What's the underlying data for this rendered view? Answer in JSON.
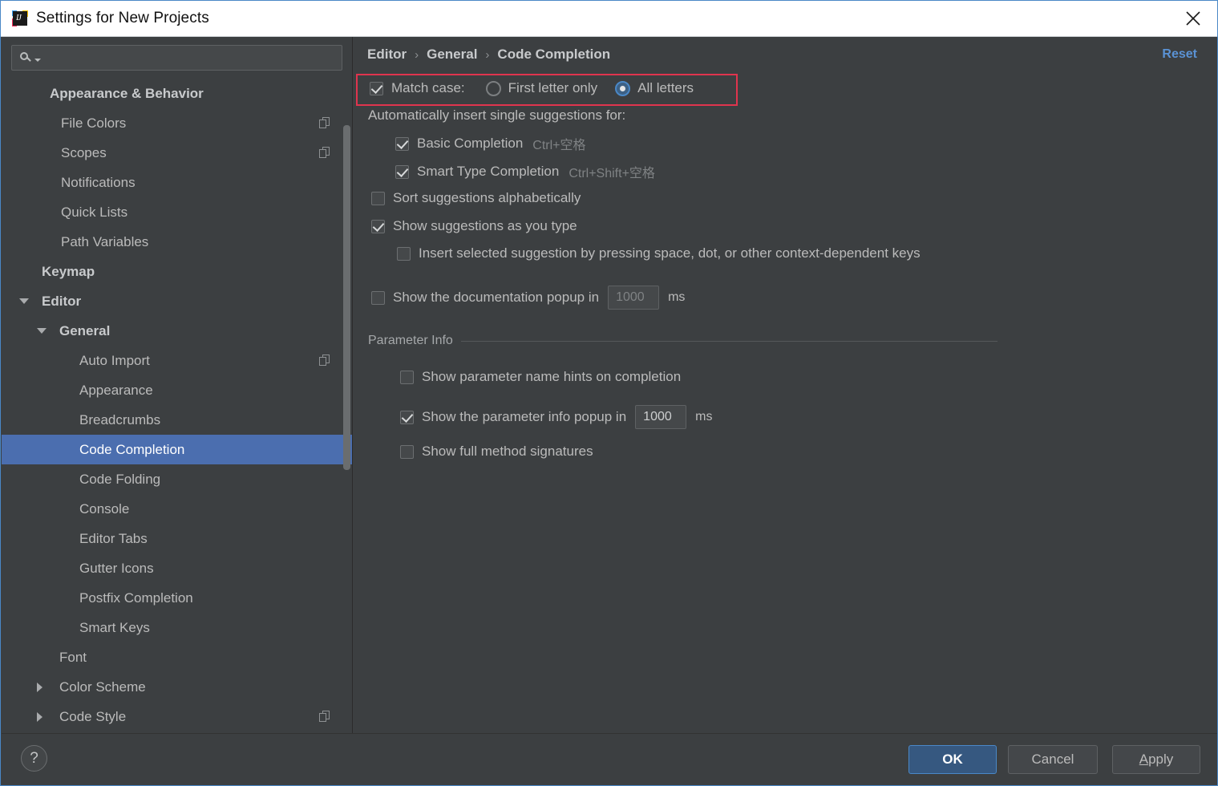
{
  "window": {
    "title": "Settings for New Projects",
    "app_icon": "intellij-idea-icon",
    "close_icon": "close-icon"
  },
  "sidebar": {
    "search": {
      "placeholder": "",
      "value": "",
      "icon": "search-icon",
      "caret_icon": "chevron-down-icon"
    },
    "items": [
      {
        "label": "Appearance & Behavior",
        "indent": 60,
        "bold": true,
        "twisty": "",
        "copy": false,
        "selected": false
      },
      {
        "label": "File Colors",
        "indent": 74,
        "bold": false,
        "twisty": "",
        "copy": true,
        "selected": false
      },
      {
        "label": "Scopes",
        "indent": 74,
        "bold": false,
        "twisty": "",
        "copy": true,
        "selected": false
      },
      {
        "label": "Notifications",
        "indent": 74,
        "bold": false,
        "twisty": "",
        "copy": false,
        "selected": false
      },
      {
        "label": "Quick Lists",
        "indent": 74,
        "bold": false,
        "twisty": "",
        "copy": false,
        "selected": false
      },
      {
        "label": "Path Variables",
        "indent": 74,
        "bold": false,
        "twisty": "",
        "copy": false,
        "selected": false
      },
      {
        "label": "Keymap",
        "indent": 50,
        "bold": true,
        "twisty": "",
        "copy": false,
        "selected": false
      },
      {
        "label": "Editor",
        "indent": 50,
        "bold": true,
        "twisty": "down",
        "copy": false,
        "selected": false
      },
      {
        "label": "General",
        "indent": 72,
        "bold": true,
        "twisty": "down",
        "copy": false,
        "selected": false
      },
      {
        "label": "Auto Import",
        "indent": 97,
        "bold": false,
        "twisty": "",
        "copy": true,
        "selected": false
      },
      {
        "label": "Appearance",
        "indent": 97,
        "bold": false,
        "twisty": "",
        "copy": false,
        "selected": false
      },
      {
        "label": "Breadcrumbs",
        "indent": 97,
        "bold": false,
        "twisty": "",
        "copy": false,
        "selected": false
      },
      {
        "label": "Code Completion",
        "indent": 97,
        "bold": false,
        "twisty": "",
        "copy": false,
        "selected": true
      },
      {
        "label": "Code Folding",
        "indent": 97,
        "bold": false,
        "twisty": "",
        "copy": false,
        "selected": false
      },
      {
        "label": "Console",
        "indent": 97,
        "bold": false,
        "twisty": "",
        "copy": false,
        "selected": false
      },
      {
        "label": "Editor Tabs",
        "indent": 97,
        "bold": false,
        "twisty": "",
        "copy": false,
        "selected": false
      },
      {
        "label": "Gutter Icons",
        "indent": 97,
        "bold": false,
        "twisty": "",
        "copy": false,
        "selected": false
      },
      {
        "label": "Postfix Completion",
        "indent": 97,
        "bold": false,
        "twisty": "",
        "copy": false,
        "selected": false
      },
      {
        "label": "Smart Keys",
        "indent": 97,
        "bold": false,
        "twisty": "",
        "copy": false,
        "selected": false
      },
      {
        "label": "Font",
        "indent": 72,
        "bold": false,
        "twisty": "",
        "copy": false,
        "selected": false
      },
      {
        "label": "Color Scheme",
        "indent": 72,
        "bold": false,
        "twisty": "right",
        "copy": false,
        "selected": false
      },
      {
        "label": "Code Style",
        "indent": 72,
        "bold": false,
        "twisty": "right",
        "copy": true,
        "selected": false
      }
    ]
  },
  "main": {
    "breadcrumb": {
      "level1": "Editor",
      "sep1": "›",
      "level2": "General",
      "sep2": "›",
      "level3": "Code Completion"
    },
    "reset_label": "Reset",
    "match_case": {
      "checkbox_label": "Match case:",
      "checked": true,
      "options": [
        {
          "label": "First letter only",
          "selected": false
        },
        {
          "label": "All letters",
          "selected": true
        }
      ]
    },
    "auto_insert_label": "Automatically insert single suggestions for:",
    "auto_insert_items": [
      {
        "label": "Basic Completion",
        "shortcut": "Ctrl+空格",
        "checked": true
      },
      {
        "label": "Smart Type Completion",
        "shortcut": "Ctrl+Shift+空格",
        "checked": true
      }
    ],
    "sort_alphabetically": {
      "label": "Sort suggestions alphabetically",
      "checked": false
    },
    "show_as_you_type": {
      "label": "Show suggestions as you type",
      "checked": true
    },
    "insert_on_keys": {
      "label": "Insert selected suggestion by pressing space, dot, or other context-dependent keys",
      "checked": false
    },
    "doc_popup": {
      "label": "Show the documentation popup in",
      "checked": false,
      "value": "1000",
      "unit": "ms",
      "enabled": false
    },
    "parameter_info": {
      "group_title": "Parameter Info",
      "hints": {
        "label": "Show parameter name hints on completion",
        "checked": false
      },
      "popup": {
        "label": "Show the parameter info popup in",
        "checked": true,
        "value": "1000",
        "unit": "ms",
        "enabled": true
      },
      "signatures": {
        "label": "Show full method signatures",
        "checked": false
      }
    },
    "annotation_color": "#e0344e"
  },
  "footer": {
    "help_label": "?",
    "ok_label": "OK",
    "cancel_label": "Cancel",
    "apply_mnemonic": "A",
    "apply_rest": "pply"
  }
}
